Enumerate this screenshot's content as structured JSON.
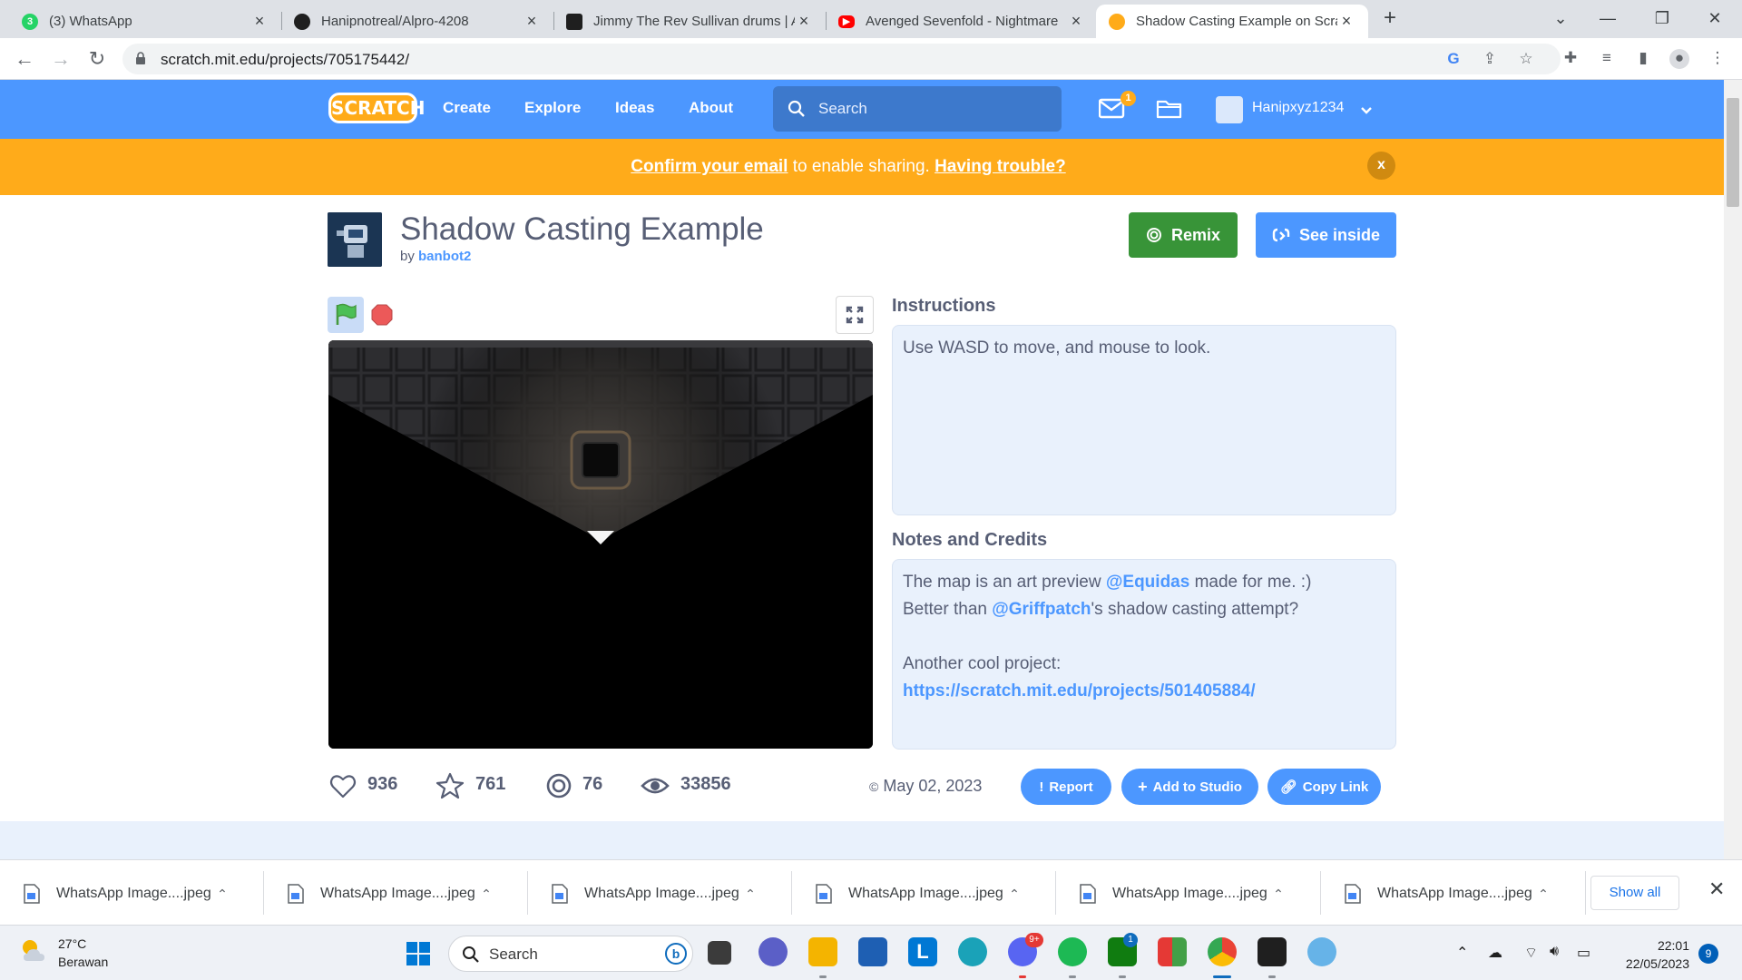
{
  "browser": {
    "tabs": [
      {
        "title": "(3) WhatsApp",
        "favicon": "whatsapp-icon",
        "badge": "3",
        "color": "#25d366"
      },
      {
        "title": "Hanipnotreal/Alpro-4208",
        "favicon": "github-icon",
        "color": "#1f1f1f"
      },
      {
        "title": "Jimmy The Rev Sullivan drums | A",
        "favicon": "video-icon",
        "color": "#1f1f1f"
      },
      {
        "title": "Avenged Sevenfold - Nightmare",
        "favicon": "youtube-icon",
        "color": "#ff0000"
      },
      {
        "title": "Shadow Casting Example on Scra",
        "favicon": "scratch-icon",
        "color": "#ffab19",
        "active": true
      }
    ],
    "new_tab": "+",
    "url": "scratch.mit.edu/projects/705175442/"
  },
  "scratch": {
    "logo_text": "SCRATCH",
    "nav": {
      "create": "Create",
      "explore": "Explore",
      "ideas": "Ideas",
      "about": "About",
      "search_placeholder": "Search",
      "messages_count": "1",
      "username": "Hanipxyz1234"
    },
    "banner": {
      "confirm_link": "Confirm your email",
      "middle_text": " to enable sharing. ",
      "trouble_link": "Having trouble?",
      "close": "x"
    },
    "project": {
      "title": "Shadow Casting Example",
      "by": "by",
      "author": "banbot2",
      "remix_label": "Remix",
      "see_inside_label": "See inside",
      "instructions_heading": "Instructions",
      "instructions_text": "Use WASD to move, and mouse to look.",
      "notes_heading": "Notes and Credits",
      "notes": {
        "line1_pre": "The map is an art preview ",
        "line1_mention": "@Equidas",
        "line1_post": " made for me. :)",
        "line2_pre": "Better than ",
        "line2_mention": "@Griffpatch",
        "line2_post": "'s shadow casting attempt?",
        "line3": "Another cool project:",
        "link": "https://scratch.mit.edu/projects/501405884/"
      },
      "stats": {
        "loves": "936",
        "favorites": "761",
        "remixes": "76",
        "views": "33856"
      },
      "date": "May 02, 2023",
      "report_label": "Report",
      "add_studio_label": "Add to Studio",
      "copy_link_label": "Copy Link"
    }
  },
  "downloads": {
    "items": [
      "WhatsApp Image....jpeg",
      "WhatsApp Image....jpeg",
      "WhatsApp Image....jpeg",
      "WhatsApp Image....jpeg",
      "WhatsApp Image....jpeg",
      "WhatsApp Image....jpeg"
    ],
    "show_all": "Show all"
  },
  "taskbar": {
    "temperature": "27°C",
    "weather": "Berawan",
    "search_placeholder": "Search",
    "time": "22:01",
    "date": "22/05/2023",
    "notifications": "9",
    "discord_badge": "9+",
    "xbox_badge": "1"
  },
  "colors": {
    "scratch_blue": "#4c97ff",
    "banner_orange": "#ffab1a",
    "remix_green": "#389438"
  }
}
